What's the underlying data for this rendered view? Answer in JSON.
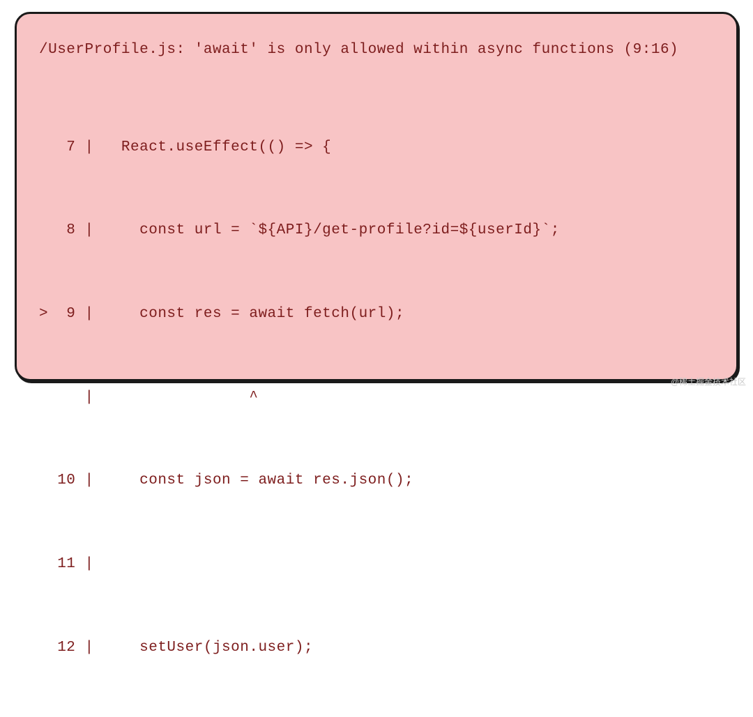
{
  "error": {
    "title": "/UserProfile.js: 'await' is only allowed within async functions (9:16)",
    "lines": [
      {
        "prefix": "   7 | ",
        "code": "  React.useEffect(() => {"
      },
      {
        "prefix": "   8 | ",
        "code": "    const url = `${API}/get-profile?id=${userId}`;"
      },
      {
        "prefix": ">  9 | ",
        "code": "    const res = await fetch(url);"
      },
      {
        "prefix": "     | ",
        "code": "                ^"
      },
      {
        "prefix": "  10 | ",
        "code": "    const json = await res.json();"
      },
      {
        "prefix": "  11 | ",
        "code": ""
      },
      {
        "prefix": "  12 | ",
        "code": "    setUser(json.user);"
      }
    ]
  },
  "watermark": "@稀土掘金技术社区"
}
